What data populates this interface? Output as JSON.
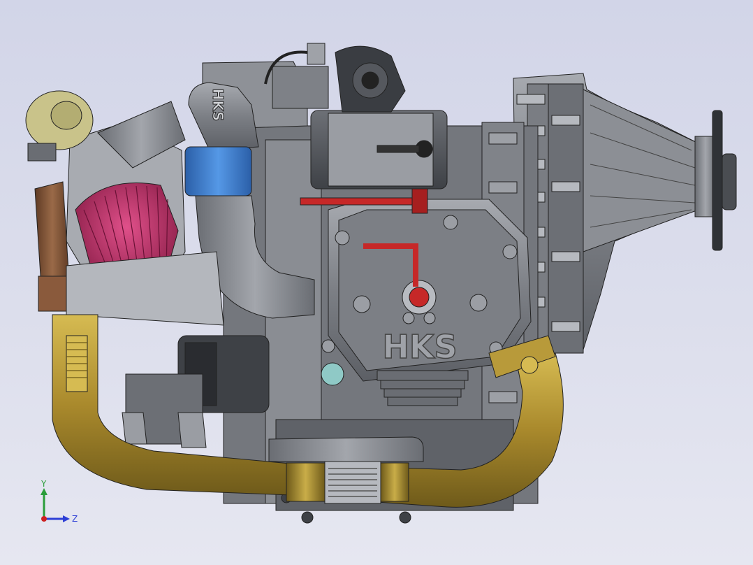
{
  "viewport": {
    "background_top": "#d2d5e8",
    "background_bottom": "#e6e7f1"
  },
  "model": {
    "valve_cover_text": "HKS",
    "intake_pipe_text": "HKS",
    "colors": {
      "metal_dark": "#55585e",
      "metal_mid": "#8a8d93",
      "metal_light": "#b9bcc2",
      "exhaust_gold": "#a98a2c",
      "exhaust_gold_light": "#cbb04a",
      "filter_pink": "#c0306a",
      "hose_blue": "#3c7fd0",
      "fuel_red": "#c62828",
      "turbo_beige": "#c9c38a",
      "manifold_brown": "#8a5a3c",
      "sensor_teal": "#8fc9c6"
    }
  },
  "triad": {
    "y_label": "Y",
    "z_label": "Z",
    "y_color": "#2a9d3a",
    "z_color": "#2d3fd6",
    "origin_color": "#c22"
  }
}
